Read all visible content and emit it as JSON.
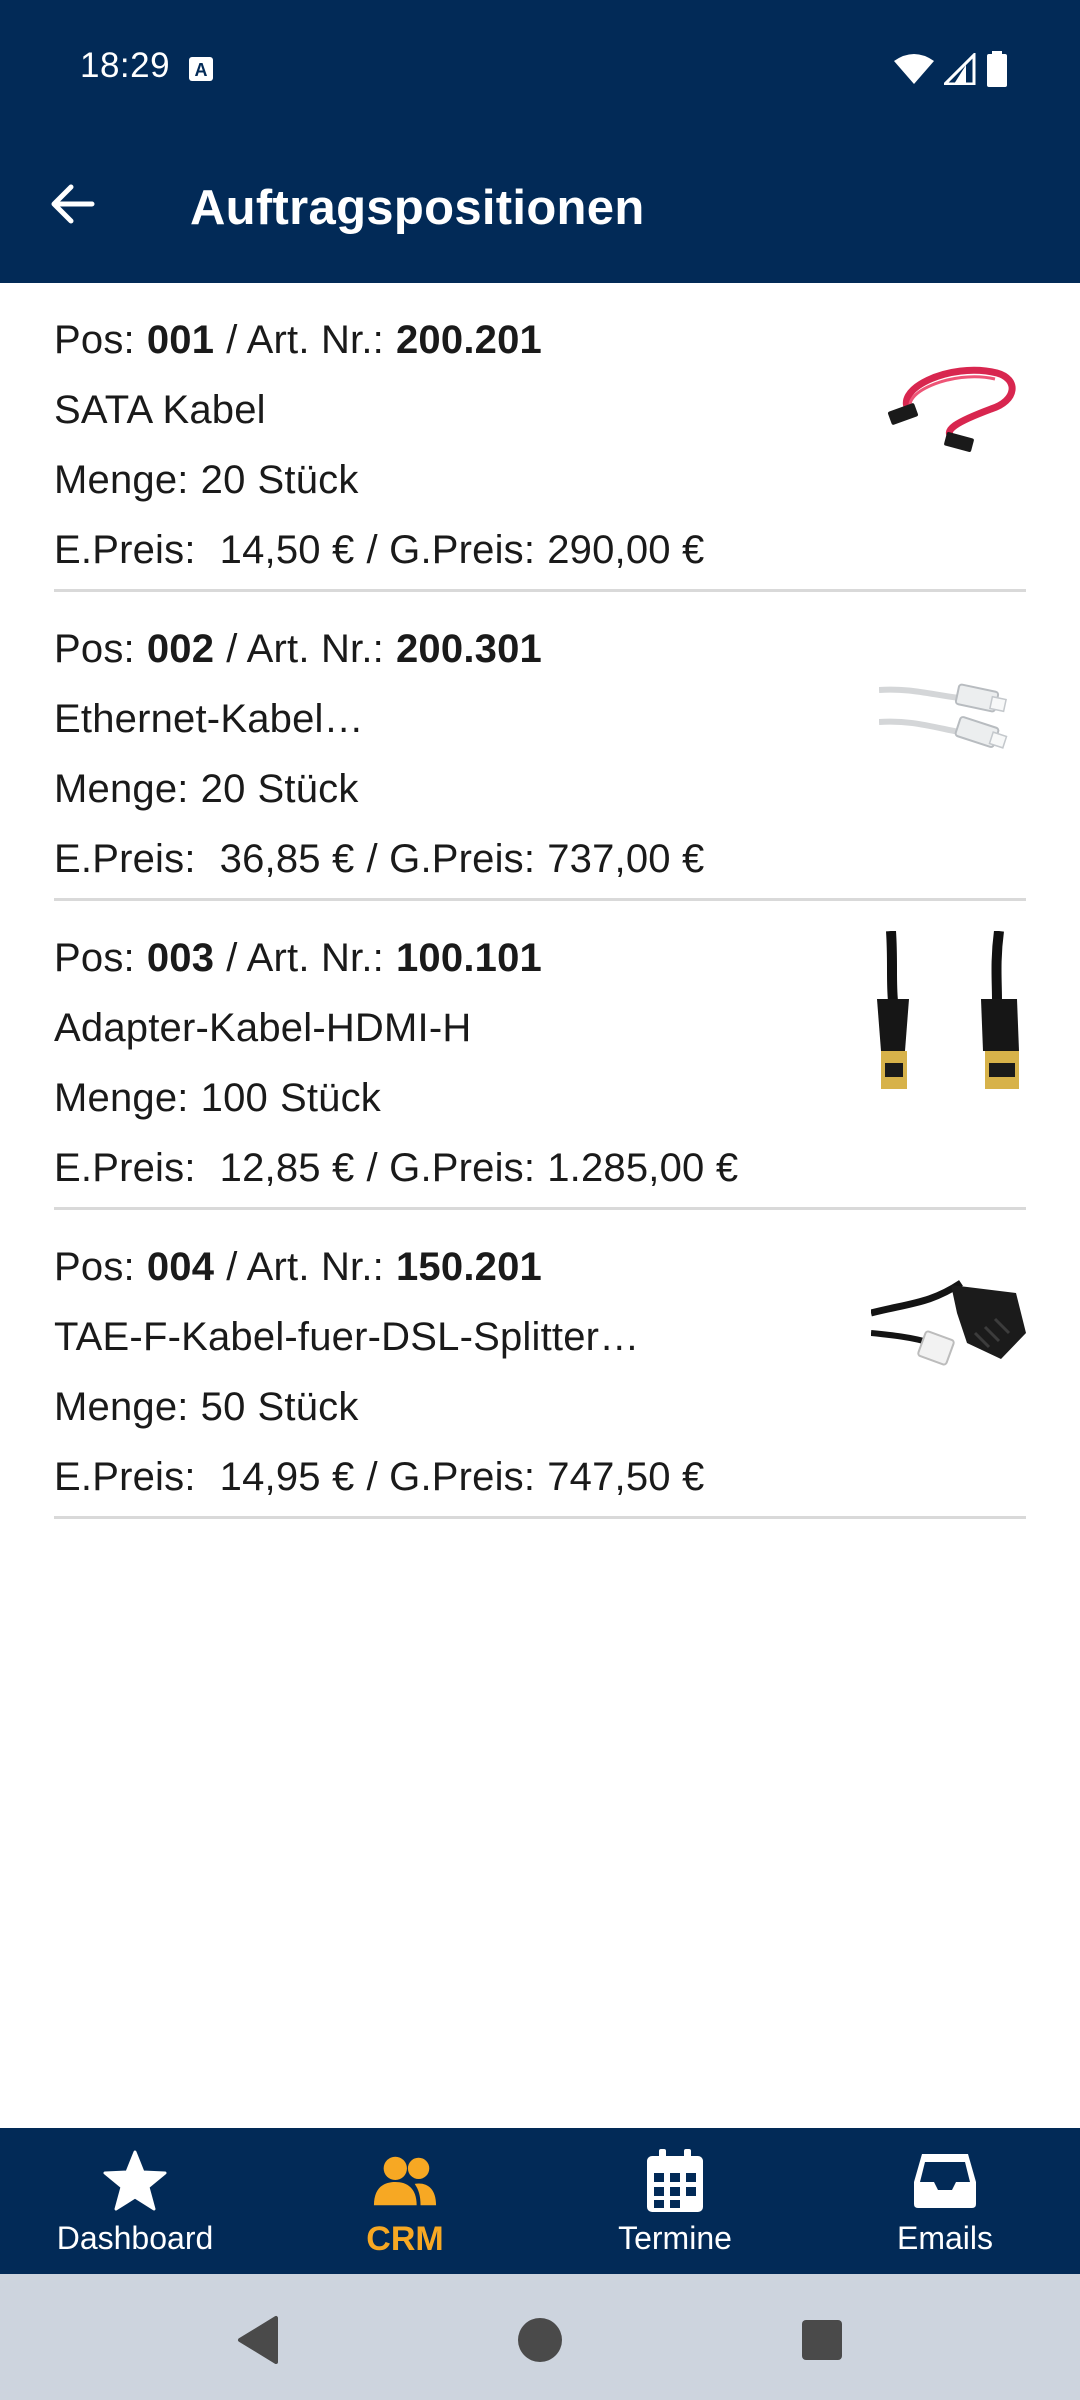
{
  "status": {
    "time": "18:29"
  },
  "appbar": {
    "title": "Auftragspositionen"
  },
  "labels": {
    "pos": "Pos:",
    "art": "/ Art. Nr.:",
    "menge": "Menge:",
    "epreis": "E.Preis:",
    "gpreis": "/ G.Preis:"
  },
  "items": [
    {
      "pos": "001",
      "art": "200.201",
      "name": "SATA Kabel",
      "qty": "20",
      "unit": "Stück",
      "eprice": "14,50 €",
      "gprice": "290,00 €",
      "image": "sata-cable-image"
    },
    {
      "pos": "002",
      "art": "200.301",
      "name": "Ethernet-Kabel…",
      "qty": "20",
      "unit": "Stück",
      "eprice": "36,85 €",
      "gprice": "737,00 €",
      "image": "ethernet-cable-image"
    },
    {
      "pos": "003",
      "art": "100.101",
      "name": "Adapter-Kabel-HDMI-H",
      "qty": "100",
      "unit": "Stück",
      "eprice": "12,85 €",
      "gprice": "1.285,00 €",
      "image": "hdmi-cable-image"
    },
    {
      "pos": "004",
      "art": "150.201",
      "name": "TAE-F-Kabel-fuer-DSL-Splitter…",
      "qty": "50",
      "unit": "Stück",
      "eprice": "14,95 €",
      "gprice": "747,50 €",
      "image": "tae-cable-image"
    }
  ],
  "bottom_nav": [
    {
      "label": "Dashboard",
      "icon": "star-icon",
      "active": false
    },
    {
      "label": "CRM",
      "icon": "users-icon",
      "active": true
    },
    {
      "label": "Termine",
      "icon": "calendar-icon",
      "active": false
    },
    {
      "label": "Emails",
      "icon": "inbox-icon",
      "active": false
    }
  ],
  "colors": {
    "primary": "#022a57",
    "accent": "#f7a823",
    "divider": "#d9d9d9"
  }
}
